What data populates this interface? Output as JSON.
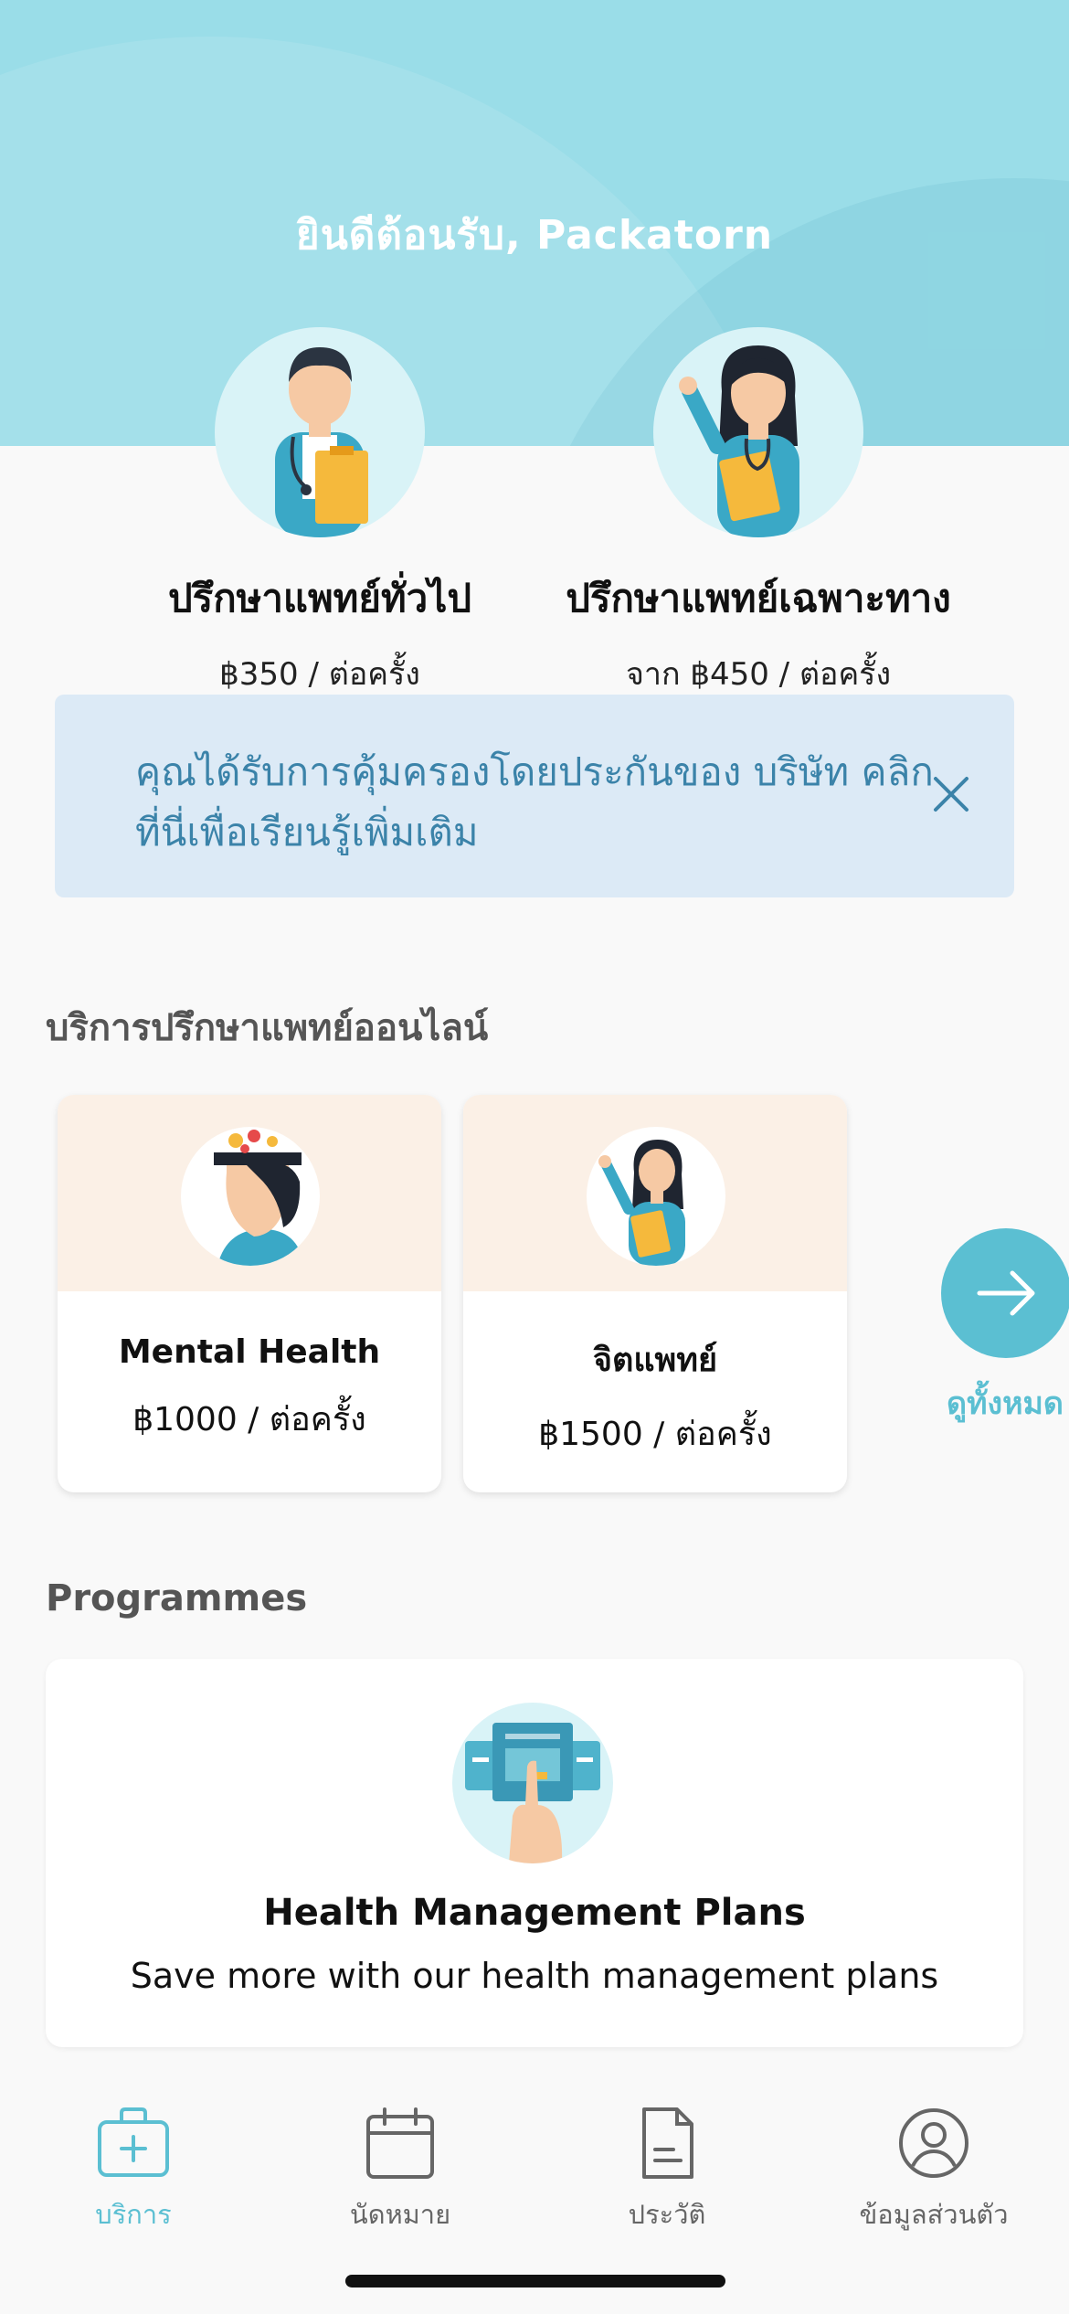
{
  "header": {
    "welcome": "ยินดีต้อนรับ, Packatorn",
    "bg_color": "#9adde8"
  },
  "consult_options": [
    {
      "title": "ปรึกษาแพทย์ทั่วไป",
      "price": "฿350 / ต่อครั้ง",
      "icon": "male-doctor-illustration"
    },
    {
      "title": "ปรึกษาแพทย์เฉพาะทาง",
      "price": "จาก ฿450 / ต่อครั้ง",
      "icon": "female-doctor-illustration"
    }
  ],
  "insurance_banner": {
    "text_line1": "คุณได้รับการคุ้มครองโดยประกันของ บริษัท  คลิก",
    "text_line2": "ที่นี่เพื่อเรียนรู้เพิ่มเติม",
    "close_icon": "close-icon"
  },
  "online_services": {
    "section_title": "บริการปรึกษาแพทย์ออนไลน์",
    "cards": [
      {
        "name": "Mental Health",
        "price": "฿1000 / ต่อครั้ง",
        "icon": "mental-health-illustration"
      },
      {
        "name": "จิตแพทย์",
        "price": "฿1500 / ต่อครั้ง",
        "icon": "psychiatrist-illustration"
      }
    ],
    "see_all_label": "ดูทั้งหมด"
  },
  "programmes": {
    "section_title": "Programmes",
    "card": {
      "title": "Health Management Plans",
      "subtitle": "Save more with our health management plans",
      "icon": "health-plan-illustration"
    }
  },
  "tabbar": {
    "items": [
      {
        "label": "บริการ",
        "icon": "medical-kit-icon",
        "active": true
      },
      {
        "label": "นัดหมาย",
        "icon": "calendar-icon",
        "active": false
      },
      {
        "label": "ประวัติ",
        "icon": "document-icon",
        "active": false
      },
      {
        "label": "ข้อมูลส่วนตัว",
        "icon": "profile-icon",
        "active": false
      }
    ]
  },
  "colors": {
    "accent": "#5bbfd2",
    "banner_bg": "#dceaf6",
    "banner_text": "#3b83a9"
  }
}
